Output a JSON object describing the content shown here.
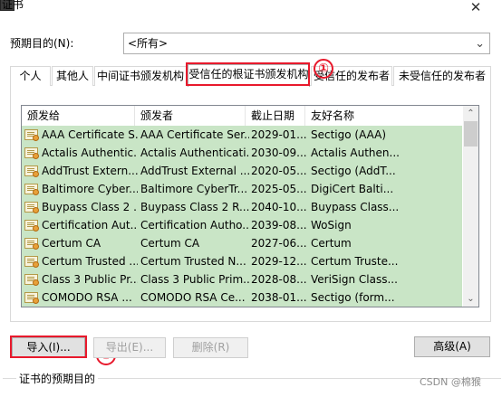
{
  "window": {
    "title": "证书",
    "close_glyph": "✕",
    "app_icon": "certificate-manager-icon"
  },
  "purpose": {
    "label": "预期目的(N):",
    "selected": "<所有>"
  },
  "tabs": [
    {
      "label": "个人"
    },
    {
      "label": "其他人"
    },
    {
      "label": "中间证书颁发机构"
    },
    {
      "label": "受信任的根证书颁发机构",
      "active": true
    },
    {
      "label": "受信任的发布者"
    },
    {
      "label": "未受信任的发布者"
    }
  ],
  "list": {
    "columns": [
      "颁发给",
      "颁发者",
      "截止日期",
      "友好名称"
    ],
    "rows": [
      {
        "issued_to": "AAA Certificate S...",
        "issued_by": "AAA Certificate Ser...",
        "expiry": "2029-01...",
        "friendly": "Sectigo (AAA)"
      },
      {
        "issued_to": "Actalis Authentic...",
        "issued_by": "Actalis Authenticati...",
        "expiry": "2030-09...",
        "friendly": "Actalis Authen..."
      },
      {
        "issued_to": "AddTrust Extern...",
        "issued_by": "AddTrust External ...",
        "expiry": "2020-05...",
        "friendly": "Sectigo (AddT..."
      },
      {
        "issued_to": "Baltimore Cyber...",
        "issued_by": "Baltimore CyberTr...",
        "expiry": "2025-05...",
        "friendly": "DigiCert Balti..."
      },
      {
        "issued_to": "Buypass Class 2 ...",
        "issued_by": "Buypass Class 2 R...",
        "expiry": "2040-10...",
        "friendly": "Buypass Class..."
      },
      {
        "issued_to": "Certification Aut...",
        "issued_by": "Certification Autho...",
        "expiry": "2039-08...",
        "friendly": "WoSign"
      },
      {
        "issued_to": "Certum CA",
        "issued_by": "Certum CA",
        "expiry": "2027-06...",
        "friendly": "Certum"
      },
      {
        "issued_to": "Certum Trusted ...",
        "issued_by": "Certum Trusted N...",
        "expiry": "2029-12...",
        "friendly": "Certum Truste..."
      },
      {
        "issued_to": "Class 3 Public Pr...",
        "issued_by": "Class 3 Public Prim...",
        "expiry": "2028-08...",
        "friendly": "VeriSign Class..."
      },
      {
        "issued_to": "COMODO RSA ...",
        "issued_by": "COMODO RSA Ce...",
        "expiry": "2038-01...",
        "friendly": "Sectigo (form..."
      }
    ],
    "row_color": "#c9e5c6",
    "scroll_up_glyph": "⌃",
    "scroll_down_glyph": "⌄"
  },
  "buttons": {
    "import": "导入(I)...",
    "export": "导出(E)...",
    "remove": "删除(R)",
    "advanced": "高级(A)"
  },
  "annotations": {
    "marker_1": "①",
    "marker_2": "②",
    "highlight_color": "#e8192c"
  },
  "group": {
    "label": "证书的预期目的"
  },
  "watermark": "CSDN @棉猴"
}
